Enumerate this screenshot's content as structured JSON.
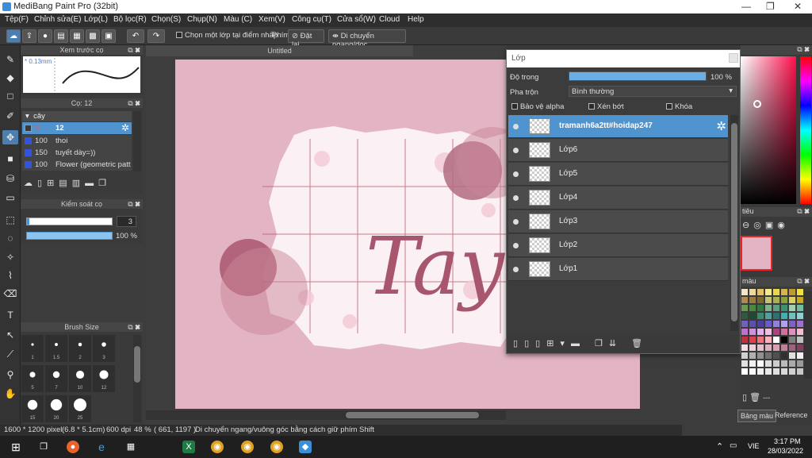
{
  "window": {
    "title": "MediBang Paint Pro (32bit)"
  },
  "menu": [
    "Tệp(F)",
    "Chỉnh sửa(E)",
    "Lớp(L)",
    "Bộ lọc(R)",
    "Chọn(S)",
    "Chụp(N)",
    "Màu (C)",
    "Xem(V)",
    "Công cụ(T)",
    "Cửa sổ(W)",
    "Cloud",
    "Help"
  ],
  "toolbar": {
    "one_layer_checkbox": "Chọn một lớp tại điểm nhấp",
    "key_label": "Phím",
    "reset_label": "Đặt lại",
    "move_label": "Di chuyển ngang/dọc"
  },
  "brush_preview": {
    "title": "Xem trước cọ",
    "size": "0.13mm"
  },
  "brush_panel": {
    "title": "Cọ: 12",
    "group": "cây",
    "items": [
      {
        "size": "3",
        "name": "12",
        "color": "#3a3a3a"
      },
      {
        "size": "100",
        "name": "thoi",
        "color": "#3355dd"
      },
      {
        "size": "150",
        "name": "tuyết dày=))",
        "color": "#3355dd"
      },
      {
        "size": "100",
        "name": "Flower (geometric patt",
        "color": "#3355dd"
      }
    ]
  },
  "brush_control": {
    "title": "Kiểm soát cọ",
    "size_value": "3",
    "opacity_value": "100 %"
  },
  "brush_size": {
    "title": "Brush Size",
    "labels": [
      "1",
      "1.5",
      "2",
      "3",
      "5",
      "7",
      "10",
      "12",
      "15",
      "20",
      "25"
    ]
  },
  "canvas": {
    "doc_title": "Untitled",
    "artwork_text": "Tay"
  },
  "layer_window": {
    "title": "Lớp",
    "opacity_label": "Độ trong",
    "opacity_value": "100 %",
    "opacity_level": 1.0,
    "blend_label": "Pha trộn",
    "blend_value": "Bình thường",
    "protect_alpha": "Bảo vệ alpha",
    "clipping": "Xén bớt",
    "lock": "Khóa",
    "layers": [
      {
        "name": "tramanh6a2tt#hoidap247",
        "selected": true
      },
      {
        "name": "Lớp6",
        "selected": false
      },
      {
        "name": "Lớp5",
        "selected": false
      },
      {
        "name": "Lớp4",
        "selected": false
      },
      {
        "name": "Lớp3",
        "selected": false
      },
      {
        "name": "Lớp2",
        "selected": false
      },
      {
        "name": "Lớp1",
        "selected": false
      }
    ]
  },
  "right_panel": {
    "nav_title": "tiêu",
    "color_title": "màu",
    "tab_color": "Bảng màu",
    "tab_reference": "Reference",
    "misc": "---"
  },
  "status": {
    "dimensions": "1600 * 1200 pixel",
    "physical": "(6.8 * 5.1cm)",
    "dpi": "600 dpi",
    "zoom": "48 %",
    "coords": "( 661, 1197 )",
    "hint": "Di chuyển ngang/vuông góc bằng cách giữ phím Shift"
  },
  "taskbar": {
    "lang": "VIE",
    "time": "3:17 PM",
    "date": "28/03/2022"
  },
  "colors": {
    "accent": "#4f93cf",
    "canvas_pink": "#e3b5c4",
    "ink": "#a8566e"
  }
}
